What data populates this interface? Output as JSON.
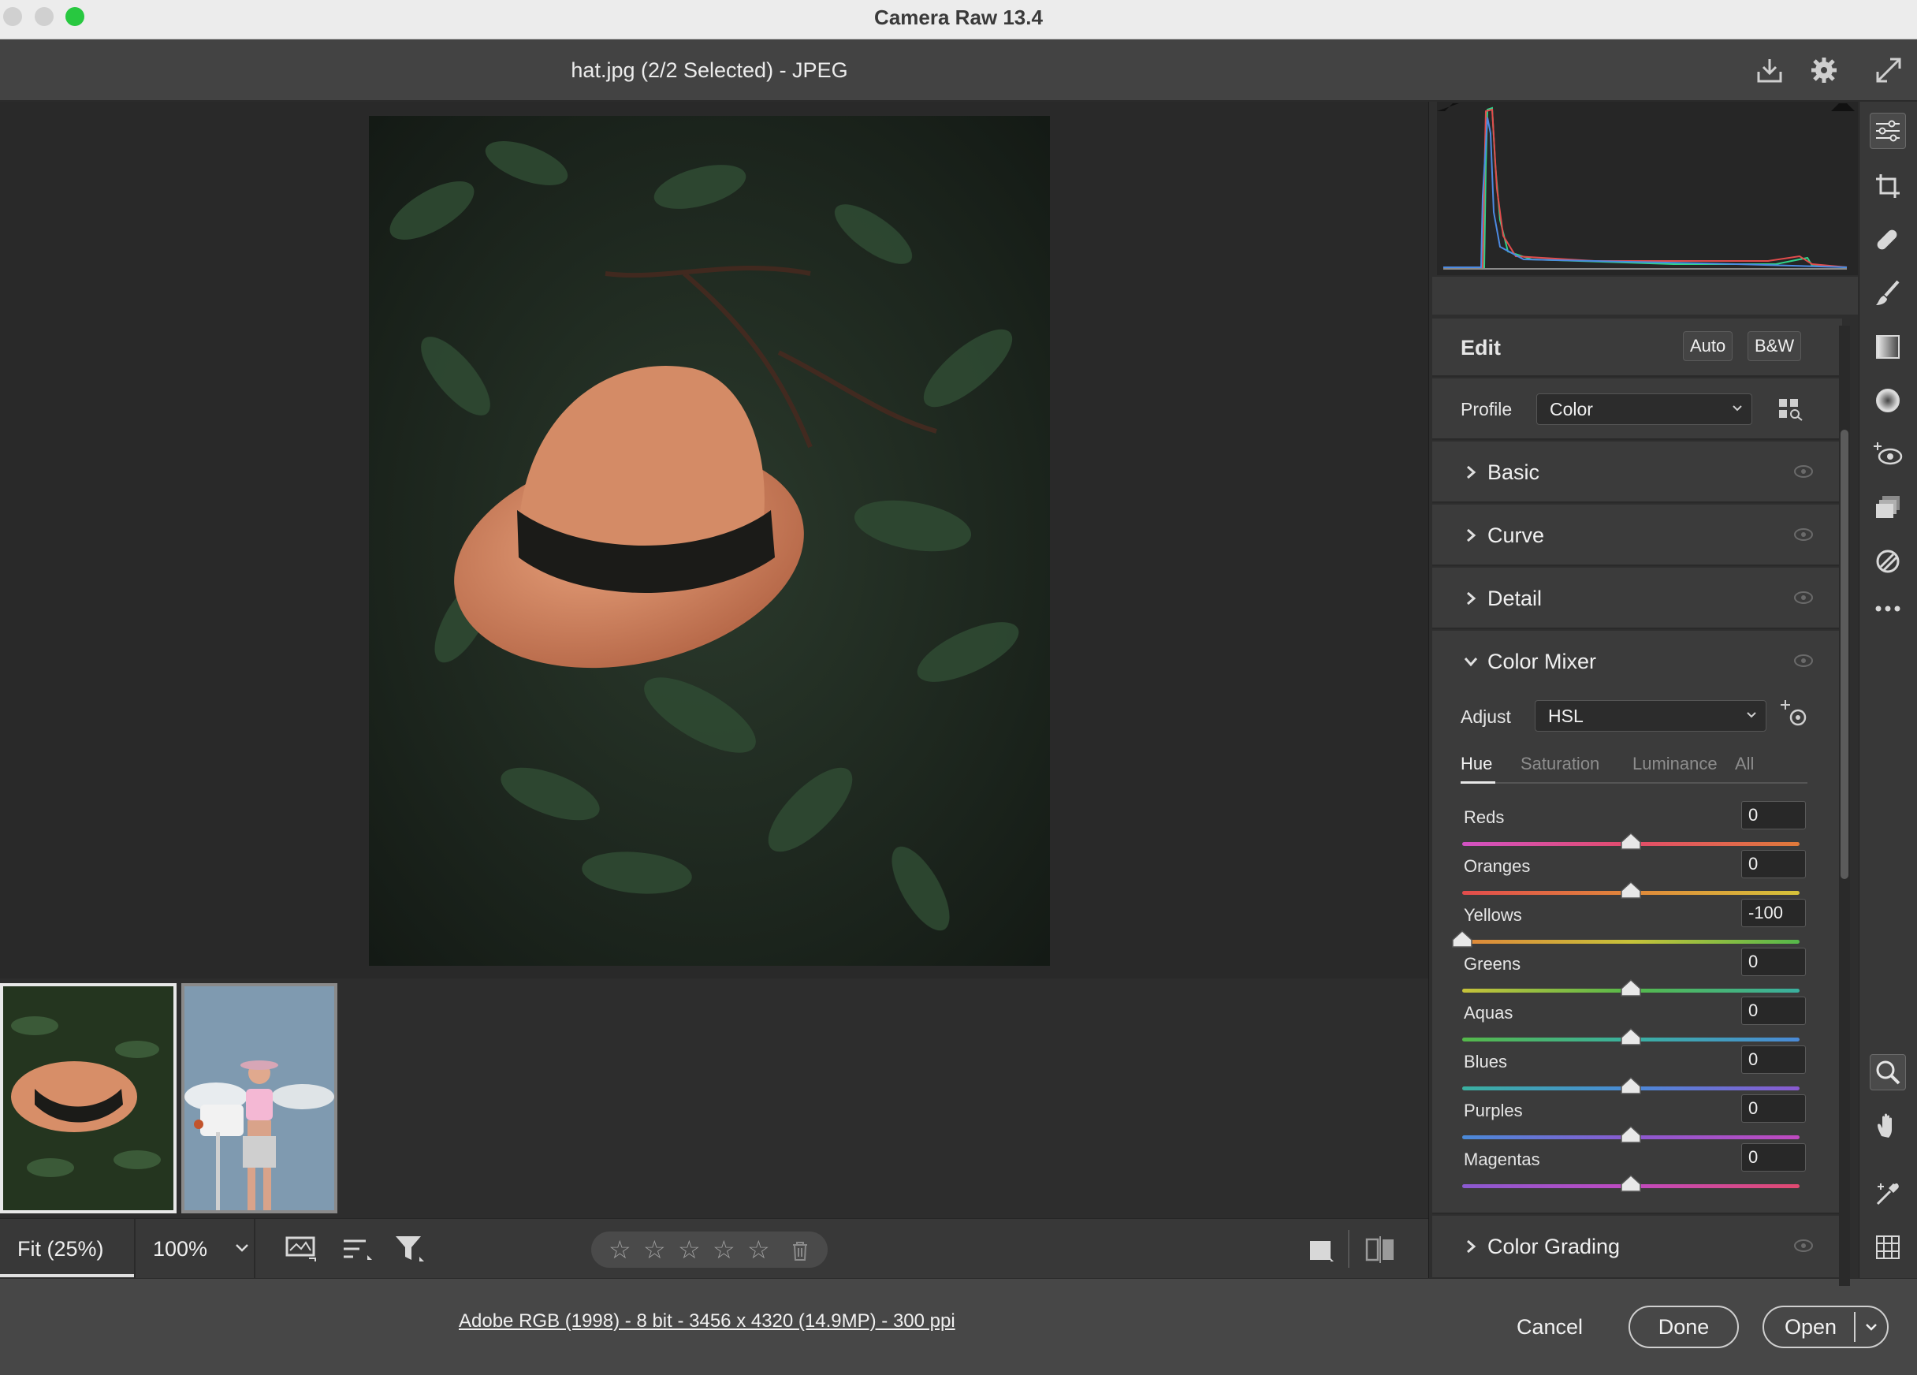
{
  "window": {
    "title": "Camera Raw 13.4"
  },
  "header": {
    "file_title": "hat.jpg (2/2 Selected)  -  JPEG"
  },
  "toolbar": {
    "fit_label": "Fit (25%)",
    "zoom_label": "100%",
    "rating_stars": 0
  },
  "footer": {
    "file_info": "Adobe RGB (1998) - 8 bit - 3456 x 4320 (14.9MP) - 300 ppi",
    "cancel_label": "Cancel",
    "done_label": "Done",
    "open_label": "Open"
  },
  "edit": {
    "title": "Edit",
    "auto_label": "Auto",
    "bw_label": "B&W",
    "profile_label": "Profile",
    "profile_value": "Color"
  },
  "sections": {
    "basic": "Basic",
    "curve": "Curve",
    "detail": "Detail",
    "color_mixer": "Color Mixer",
    "color_grading": "Color Grading"
  },
  "color_mixer": {
    "adjust_label": "Adjust",
    "adjust_value": "HSL",
    "tabs": [
      "Hue",
      "Saturation",
      "Luminance",
      "All"
    ],
    "active_tab": "Hue",
    "sliders": [
      {
        "label": "Reds",
        "value": "0"
      },
      {
        "label": "Oranges",
        "value": "0"
      },
      {
        "label": "Yellows",
        "value": "-100"
      },
      {
        "label": "Greens",
        "value": "0"
      },
      {
        "label": "Aquas",
        "value": "0"
      },
      {
        "label": "Blues",
        "value": "0"
      },
      {
        "label": "Purples",
        "value": "0"
      },
      {
        "label": "Magentas",
        "value": "0"
      }
    ],
    "slider_range": [
      -100,
      100
    ]
  },
  "icons": {
    "save": "download-icon",
    "settings": "gear-icon",
    "fullscreen": "expand-icon",
    "tools": [
      "edit-sliders-icon",
      "crop-icon",
      "healing-icon",
      "brush-icon",
      "gradient-icon",
      "radial-filter-icon",
      "red-eye-icon",
      "snapshots-icon",
      "presets-icon",
      "more-icon",
      "zoom-icon",
      "hand-icon",
      "color-sampler-icon",
      "grid-icon"
    ]
  }
}
